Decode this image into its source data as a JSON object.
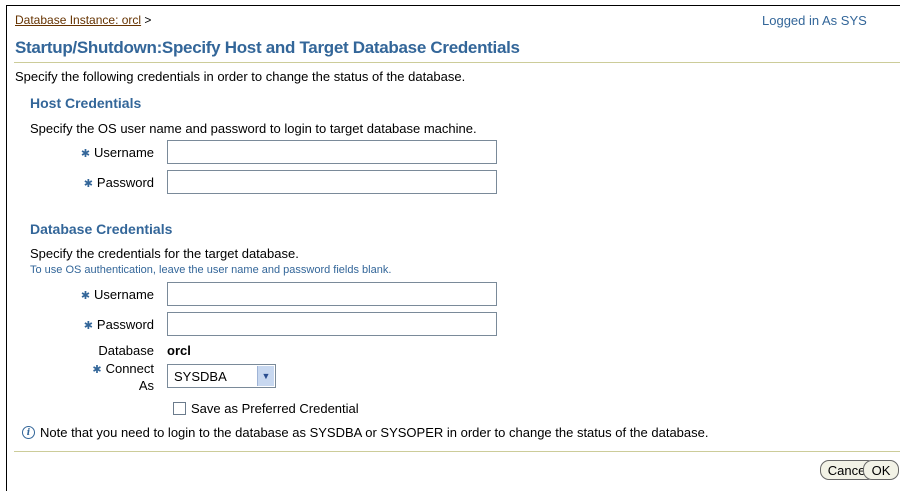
{
  "breadcrumb": {
    "link": "Database Instance: orcl",
    "separator": ">"
  },
  "session": {
    "logged_in": "Logged in As SYS"
  },
  "page": {
    "title": "Startup/Shutdown:Specify Host and Target Database Credentials",
    "intro": "Specify the following credentials in order to change the status of the database."
  },
  "host": {
    "heading": "Host Credentials",
    "description": "Specify the OS user name and password to login to target database machine.",
    "username_label": "Username",
    "username_value": "",
    "password_label": "Password",
    "password_value": ""
  },
  "database": {
    "heading": "Database Credentials",
    "description": "Specify the credentials for the target database.",
    "tip": "To use OS authentication, leave the user name and password fields blank.",
    "username_label": "Username",
    "username_value": "",
    "password_label": "Password",
    "password_value": "",
    "database_label": "Database",
    "database_value": "orcl",
    "connect_as_label_line1": "Connect",
    "connect_as_label_line2": "As",
    "connect_as_value": "SYSDBA",
    "preferred_label": "Save as Preferred Credential",
    "preferred_checked": false
  },
  "note": "Note that you need to login to the database as SYSDBA or SYSOPER in order to change the status of the database.",
  "buttons": {
    "cancel": "Cancel",
    "ok": "OK"
  },
  "colors": {
    "accent": "#336699",
    "link": "#663300",
    "rule": "#cccc99"
  },
  "icons": {
    "required": "asterisk",
    "info": "info-icon",
    "dropdown": "chevron-down-icon"
  }
}
